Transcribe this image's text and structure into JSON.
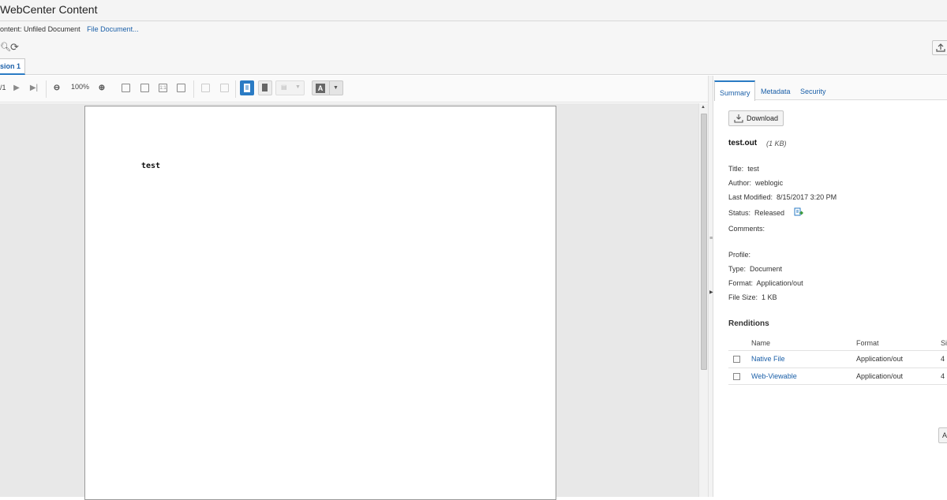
{
  "app": {
    "title": "WebCenter Content"
  },
  "breadcrumb": {
    "prefix": "ontent:",
    "location": "Unfiled Document",
    "link": "File Document..."
  },
  "version_tab": {
    "label": "sion 1"
  },
  "viewer": {
    "page_indicator": "/1",
    "zoom": "100%",
    "document_text": "test"
  },
  "panel": {
    "tabs": [
      "Summary",
      "Metadata",
      "Security"
    ],
    "download_label": "Download",
    "file_name": "test.out",
    "file_size_small": "(1 KB)",
    "properties": [
      {
        "label": "Title:",
        "value": "test"
      },
      {
        "label": "Author:",
        "value": "weblogic"
      },
      {
        "label": "Last Modified:",
        "value": "8/15/2017 3:20 PM"
      },
      {
        "label": "Status:",
        "value": "Released"
      },
      {
        "label": "Comments:",
        "value": ""
      },
      {
        "label": "Profile:",
        "value": ""
      },
      {
        "label": "Type:",
        "value": "Document"
      },
      {
        "label": "Format:",
        "value": "Application/out"
      },
      {
        "label": "File Size:",
        "value": "1 KB"
      }
    ],
    "renditions": {
      "title": "Renditions",
      "columns": [
        "Name",
        "Format",
        "Si"
      ],
      "rows": [
        {
          "name": "Native File",
          "format": "Application/out",
          "size": "4"
        },
        {
          "name": "Web-Viewable",
          "format": "Application/out",
          "size": "4"
        }
      ]
    },
    "apply_label": "A"
  },
  "colors": {
    "accent": "#2a7bc4",
    "link": "#1a5fa8",
    "status_icon": "#3a9a3a"
  }
}
